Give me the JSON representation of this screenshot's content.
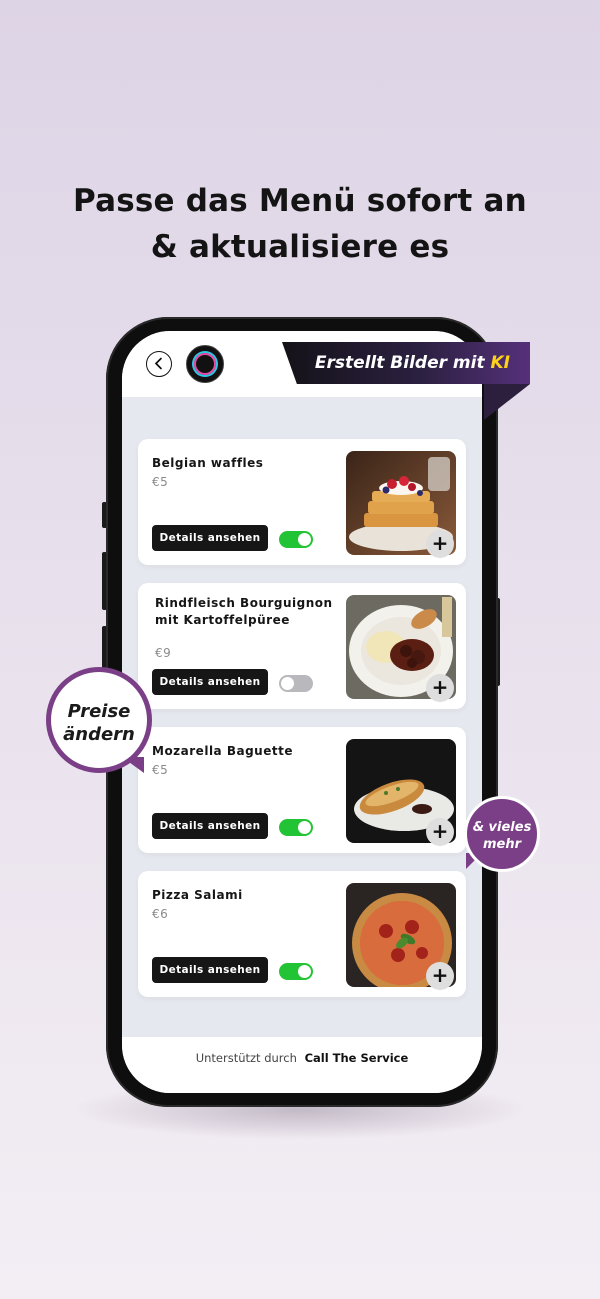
{
  "headline": {
    "line1": "Passe das Menü sofort an",
    "line2": "& aktualisiere es"
  },
  "app": {
    "back_icon": "chevron-left-icon",
    "logo_icon": "restaurant-logo-icon"
  },
  "banner": {
    "text": "Erstellt Bilder mit ",
    "highlight": "KI",
    "highlight_color": "#ffd21a"
  },
  "menu_items": [
    {
      "name": "Belgian waffles",
      "price": "€5",
      "details_label": "Details ansehen",
      "enabled": true,
      "add_label": "+"
    },
    {
      "name": "Rindfleisch Bourguignon mit Kartoffelpüree",
      "price": "€9",
      "details_label": "Details ansehen",
      "enabled": false,
      "add_label": "+"
    },
    {
      "name": "Mozarella Baguette",
      "price": "€5",
      "details_label": "Details ansehen",
      "enabled": true,
      "add_label": "+"
    },
    {
      "name": "Pizza Salami",
      "price": "€6",
      "details_label": "Details ansehen",
      "enabled": true,
      "add_label": "+"
    }
  ],
  "footer": {
    "prefix": "Unterstützt durch",
    "brand": "Call The Service"
  },
  "bubbles": {
    "preise_line1": "Preise",
    "preise_line2": "ändern",
    "mehr_line1": "& vieles",
    "mehr_line2": "mehr"
  },
  "colors": {
    "accent_purple": "#7a3f86",
    "toggle_on": "#22c435",
    "toggle_off": "#b9b9bd",
    "button_dark": "#161616"
  }
}
